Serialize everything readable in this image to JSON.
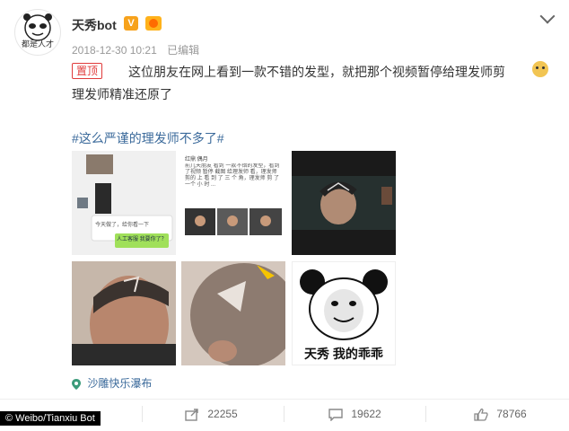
{
  "post": {
    "username": "天秀bot",
    "avatar_caption": "都是人才",
    "datetime": "2018-12-30 10:21",
    "edited": "已编辑",
    "pinned_label": "置顶",
    "text_line1": "这位朋友在网上看到一款不错的发型，就把那个视频暂停给理发师剪",
    "text_line2": "理发师精准还原了",
    "hashtag": "#这么严谨的理发师不多了#",
    "location": "沙雕快乐瀑布",
    "meme_caption": "天秀 我的乖乖",
    "chat_bubble_text": "今天做了，给你看一下",
    "chat_card_text": "人工客服 我要你了？",
    "article_title": "红鼎 偶月",
    "article_text": "前几天朋友 看到 一款不错的发型，看到了视频 暂停 截图 给理发师 看，理发师 剪的 上 看 到 了 三 个 角，理发师 剪 了 一个 小 时 ..."
  },
  "actions": {
    "share_count": "22255",
    "comment_count": "19622",
    "like_count": "78766"
  },
  "watermark": "© Weibo/Tianxiu Bot",
  "colors": {
    "link": "#3b6a9b",
    "pin": "#e03b3b",
    "badge": "#f7a21b"
  }
}
